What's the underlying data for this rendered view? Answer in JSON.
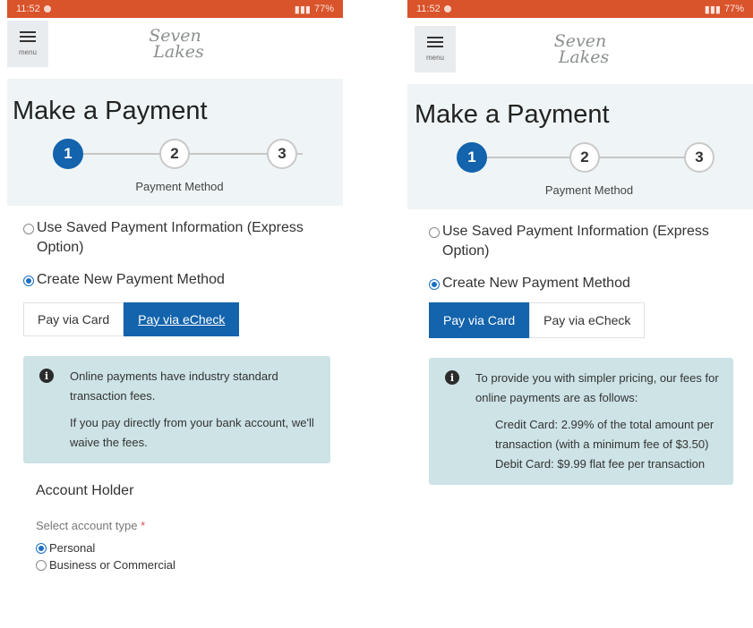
{
  "left": {
    "status": {
      "time": "11:52",
      "battery": "77%"
    },
    "menu_label": "menu",
    "logo": {
      "line1": "Seven",
      "line2": "Lakes"
    },
    "title": "Make a Payment",
    "steps": [
      "1",
      "2",
      "3"
    ],
    "step_label": "Payment Method",
    "options": {
      "saved": "Use Saved Payment Information (Express Option)",
      "new": "Create New Payment Method"
    },
    "tabs": {
      "card": "Pay via Card",
      "echeck": "Pay via eCheck"
    },
    "info": {
      "p1": "Online payments have industry standard transaction fees.",
      "p2": "If you pay directly from your bank account, we'll waive the fees."
    },
    "account_holder": "Account Holder",
    "account_type_label": "Select account type",
    "required_mark": "*",
    "account_types": {
      "personal": "Personal",
      "business": "Business or Commercial"
    }
  },
  "right": {
    "status": {
      "time": "11:52",
      "battery": "77%"
    },
    "menu_label": "menu",
    "logo": {
      "line1": "Seven",
      "line2": "Lakes"
    },
    "title": "Make a Payment",
    "steps": [
      "1",
      "2",
      "3"
    ],
    "step_label": "Payment Method",
    "options": {
      "saved": "Use Saved Payment Information (Express Option)",
      "new": "Create New Payment Method"
    },
    "tabs": {
      "card": "Pay via Card",
      "echeck": "Pay via eCheck"
    },
    "info": {
      "p1": "To provide you with simpler pricing, our fees for online payments are as follows:",
      "credit": "Credit Card: 2.99% of the total amount per transaction (with a minimum fee of $3.50)",
      "debit": "Debit Card: $9.99 flat fee per transaction"
    }
  },
  "colors": {
    "statusbar": "#d9532b",
    "primary": "#1363ad",
    "hero_bg": "#eff5f6",
    "info_bg": "#cde3e6"
  },
  "icons": [
    "hamburger-menu-icon",
    "info-icon",
    "radio-icon"
  ]
}
